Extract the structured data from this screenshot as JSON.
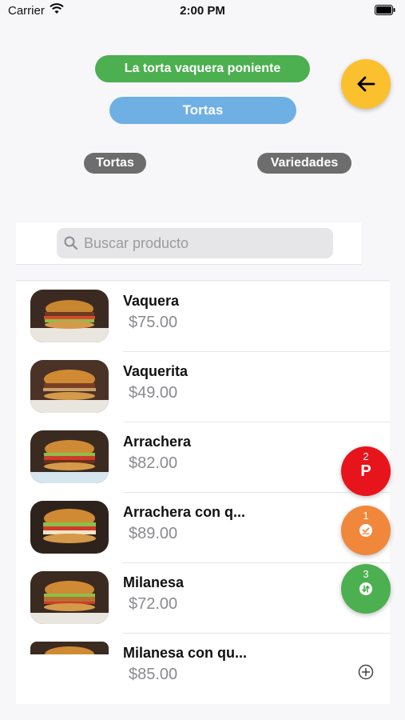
{
  "status_bar": {
    "carrier": "Carrier",
    "time": "2:00 PM"
  },
  "header": {
    "store_name": "La torta vaquera poniente",
    "category": "Tortas",
    "colors": {
      "store": "#4caf50",
      "category": "#6fb0e4",
      "back": "#fbc02d"
    }
  },
  "filters": {
    "chips": [
      "Tortas",
      "Variedades"
    ]
  },
  "search": {
    "placeholder": "Buscar producto",
    "value": ""
  },
  "products": [
    {
      "name": "Vaquera",
      "price": "$75.00"
    },
    {
      "name": "Vaquerita",
      "price": "$49.00"
    },
    {
      "name": "Arrachera",
      "price": "$82.00"
    },
    {
      "name": "Arrachera con q...",
      "price": "$89.00"
    },
    {
      "name": "Milanesa",
      "price": "$72.00"
    },
    {
      "name": "Milanesa con qu...",
      "price": "$85.00"
    }
  ],
  "fabs": {
    "pending": {
      "count": "2",
      "letter": "P",
      "color": "#e8141b"
    },
    "confirmed": {
      "count": "1",
      "icon": "check-clock-icon",
      "color": "#f0873a"
    },
    "transfers": {
      "count": "3",
      "icon": "swap-icon",
      "color": "#4caf50"
    }
  },
  "icons": [
    "wifi-icon",
    "battery-icon",
    "back-arrow-icon",
    "search-icon",
    "add-circle-icon"
  ]
}
